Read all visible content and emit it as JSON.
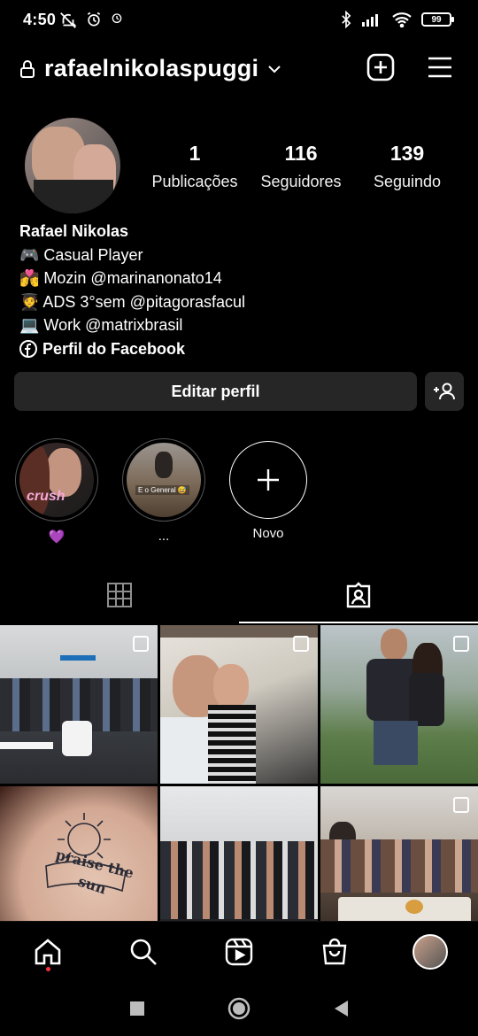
{
  "status": {
    "time": "4:50",
    "battery": "99"
  },
  "header": {
    "username": "rafaelnikolaspuggi"
  },
  "profile": {
    "stats": [
      {
        "num": "1",
        "label": "Publicações"
      },
      {
        "num": "116",
        "label": "Seguidores"
      },
      {
        "num": "139",
        "label": "Seguindo"
      }
    ],
    "name": "Rafael Nikolas",
    "bio_lines": [
      "🎮 Casual Player",
      "💏 Mozin @marinanonato14",
      "🧑‍🎓 ADS 3°sem @pitagorasfacul",
      "💻 Work @matrixbrasil"
    ],
    "facebook_link": "Perfil do Facebook",
    "edit_button": "Editar perfil"
  },
  "highlights": [
    {
      "label": "💜",
      "overlay": "crush"
    },
    {
      "label": "...",
      "overlay": "E o General 😅"
    },
    {
      "label": "Novo"
    }
  ],
  "colors": {
    "background": "#000000",
    "button": "#262626",
    "notification_dot": "#ff3040"
  }
}
